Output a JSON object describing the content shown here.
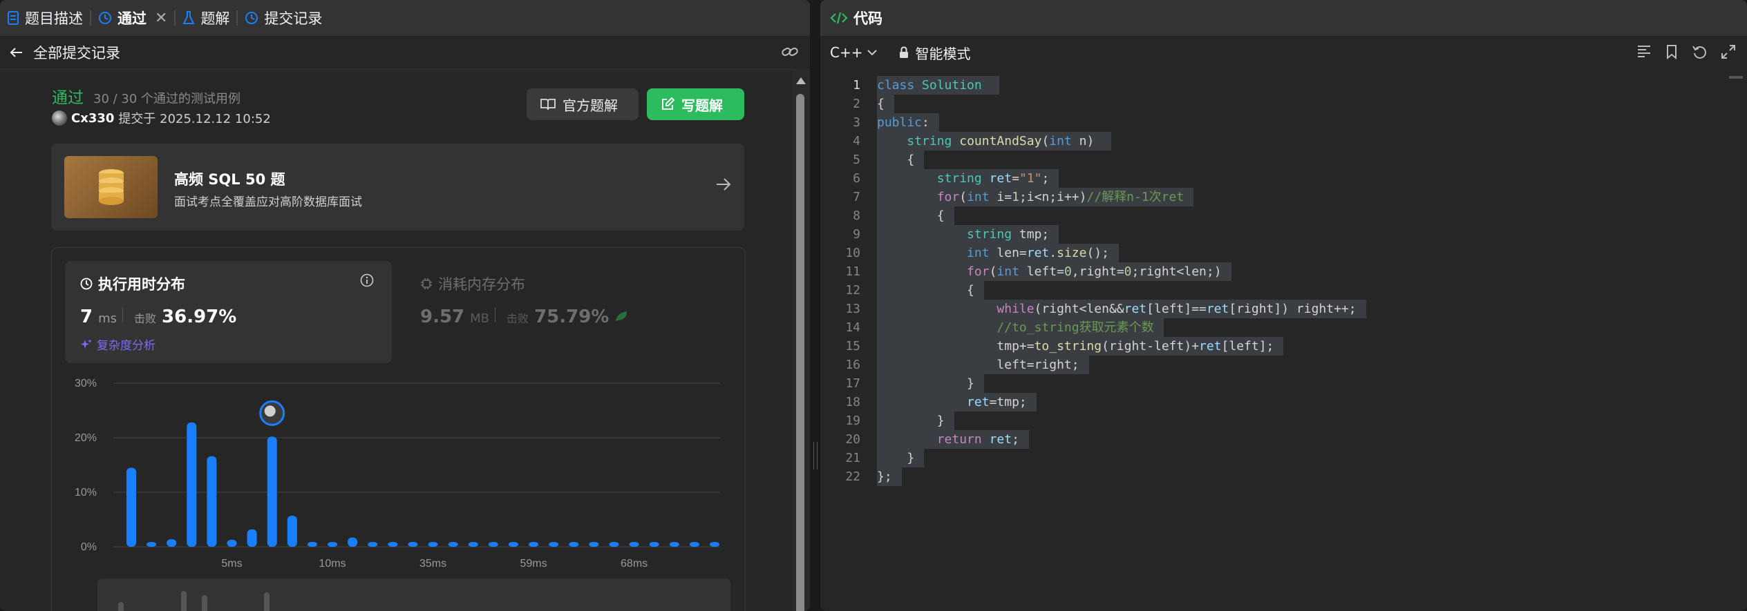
{
  "left": {
    "tabs": [
      {
        "label": "题目描述",
        "icon": "document-icon"
      },
      {
        "label": "通过",
        "icon": "history-icon",
        "active": true
      },
      {
        "label": "题解",
        "icon": "flask-icon"
      },
      {
        "label": "提交记录",
        "icon": "history-icon"
      }
    ],
    "back_label": "全部提交记录",
    "status": {
      "label": "通过",
      "cases": "30 / 30 个通过的测试用例"
    },
    "author": {
      "name": "Cx330",
      "submitted": "提交于 2025.12.12 10:52"
    },
    "buttons": {
      "official": "官方题解",
      "write": "写题解"
    },
    "promo": {
      "title": "高频 SQL 50 题",
      "desc": "面试考点全覆盖应对高阶数据库面试"
    },
    "runtime": {
      "title": "执行用时分布",
      "value": "7",
      "unit": "ms",
      "beat_label": "击败",
      "beat_pct": "36.97%",
      "complexity": "复杂度分析"
    },
    "memory": {
      "title": "消耗内存分布",
      "value": "9.57",
      "unit": "MB",
      "beat_label": "击败",
      "beat_pct": "75.79%"
    }
  },
  "chart_data": {
    "type": "bar",
    "ylim": [
      0,
      30
    ],
    "y_ticks": [
      "30%",
      "20%",
      "10%",
      "0%"
    ],
    "x_tick_labels": [
      "5ms",
      "10ms",
      "35ms",
      "59ms",
      "68ms"
    ],
    "values": [
      14.5,
      0.8,
      1.4,
      22.8,
      16.6,
      1.3,
      3.2,
      20.2,
      5.7,
      0.7,
      0.7,
      1.7,
      0.7,
      0.7,
      0.7,
      0.7,
      0.7,
      0.7,
      0.7,
      0.7,
      0.7,
      0.7,
      0.7,
      0.7,
      0.7,
      0.7,
      0.7,
      0.7,
      0.7,
      0.7
    ],
    "highlight_index": 7,
    "bar_color": "#1a7fff"
  },
  "right": {
    "title": "代码",
    "language": "C++",
    "mode": "智能模式",
    "code_lines": [
      "class Solution ",
      "{",
      "public:",
      "    string countAndSay(int n) ",
      "    {",
      "        string ret=\"1\";",
      "        for(int i=1;i<n;i++)//解释n-1次ret",
      "        {",
      "            string tmp;",
      "            int len=ret.size();",
      "            for(int left=0,right=0;right<len;)",
      "            {",
      "                while(right<len&&ret[left]==ret[right]) right++;",
      "                //to_string获取元素个数",
      "                tmp+=to_string(right-left)+ret[left];",
      "                left=right;",
      "            }",
      "            ret=tmp;",
      "        }",
      "        return ret;",
      "    }",
      "};"
    ]
  }
}
